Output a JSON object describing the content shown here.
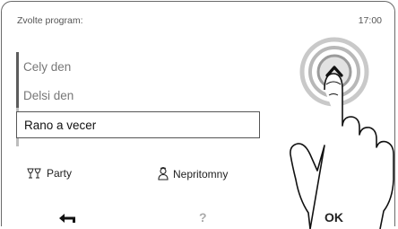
{
  "header": {
    "title": "Zvolte program:",
    "time": "17:00"
  },
  "program_list": {
    "items": [
      "Cely den",
      "Delsi den",
      "Rano a vecer"
    ],
    "selected_index": 2
  },
  "modes": {
    "party_label": "Party",
    "absent_label": "Nepritomny"
  },
  "nav": {
    "help_label": "?",
    "ok_label": "OK"
  },
  "icons": {
    "back": "back-arrow-icon",
    "up": "chevron-up-icon",
    "party": "glasses-icon",
    "absent": "person-icon",
    "hand": "pointing-hand-icon"
  }
}
